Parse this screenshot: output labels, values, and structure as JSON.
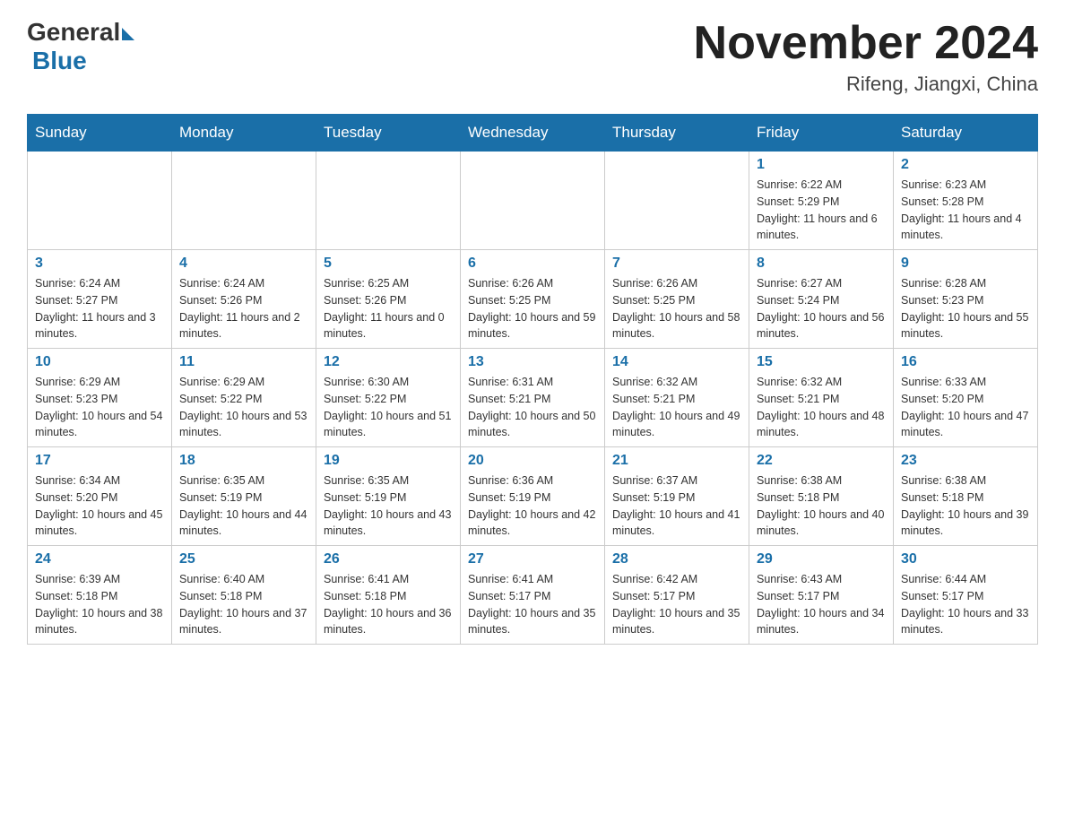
{
  "header": {
    "logo_general": "General",
    "logo_blue": "Blue",
    "month_title": "November 2024",
    "location": "Rifeng, Jiangxi, China"
  },
  "weekdays": [
    "Sunday",
    "Monday",
    "Tuesday",
    "Wednesday",
    "Thursday",
    "Friday",
    "Saturday"
  ],
  "weeks": [
    [
      {
        "day": "",
        "info": ""
      },
      {
        "day": "",
        "info": ""
      },
      {
        "day": "",
        "info": ""
      },
      {
        "day": "",
        "info": ""
      },
      {
        "day": "",
        "info": ""
      },
      {
        "day": "1",
        "info": "Sunrise: 6:22 AM\nSunset: 5:29 PM\nDaylight: 11 hours and 6 minutes."
      },
      {
        "day": "2",
        "info": "Sunrise: 6:23 AM\nSunset: 5:28 PM\nDaylight: 11 hours and 4 minutes."
      }
    ],
    [
      {
        "day": "3",
        "info": "Sunrise: 6:24 AM\nSunset: 5:27 PM\nDaylight: 11 hours and 3 minutes."
      },
      {
        "day": "4",
        "info": "Sunrise: 6:24 AM\nSunset: 5:26 PM\nDaylight: 11 hours and 2 minutes."
      },
      {
        "day": "5",
        "info": "Sunrise: 6:25 AM\nSunset: 5:26 PM\nDaylight: 11 hours and 0 minutes."
      },
      {
        "day": "6",
        "info": "Sunrise: 6:26 AM\nSunset: 5:25 PM\nDaylight: 10 hours and 59 minutes."
      },
      {
        "day": "7",
        "info": "Sunrise: 6:26 AM\nSunset: 5:25 PM\nDaylight: 10 hours and 58 minutes."
      },
      {
        "day": "8",
        "info": "Sunrise: 6:27 AM\nSunset: 5:24 PM\nDaylight: 10 hours and 56 minutes."
      },
      {
        "day": "9",
        "info": "Sunrise: 6:28 AM\nSunset: 5:23 PM\nDaylight: 10 hours and 55 minutes."
      }
    ],
    [
      {
        "day": "10",
        "info": "Sunrise: 6:29 AM\nSunset: 5:23 PM\nDaylight: 10 hours and 54 minutes."
      },
      {
        "day": "11",
        "info": "Sunrise: 6:29 AM\nSunset: 5:22 PM\nDaylight: 10 hours and 53 minutes."
      },
      {
        "day": "12",
        "info": "Sunrise: 6:30 AM\nSunset: 5:22 PM\nDaylight: 10 hours and 51 minutes."
      },
      {
        "day": "13",
        "info": "Sunrise: 6:31 AM\nSunset: 5:21 PM\nDaylight: 10 hours and 50 minutes."
      },
      {
        "day": "14",
        "info": "Sunrise: 6:32 AM\nSunset: 5:21 PM\nDaylight: 10 hours and 49 minutes."
      },
      {
        "day": "15",
        "info": "Sunrise: 6:32 AM\nSunset: 5:21 PM\nDaylight: 10 hours and 48 minutes."
      },
      {
        "day": "16",
        "info": "Sunrise: 6:33 AM\nSunset: 5:20 PM\nDaylight: 10 hours and 47 minutes."
      }
    ],
    [
      {
        "day": "17",
        "info": "Sunrise: 6:34 AM\nSunset: 5:20 PM\nDaylight: 10 hours and 45 minutes."
      },
      {
        "day": "18",
        "info": "Sunrise: 6:35 AM\nSunset: 5:19 PM\nDaylight: 10 hours and 44 minutes."
      },
      {
        "day": "19",
        "info": "Sunrise: 6:35 AM\nSunset: 5:19 PM\nDaylight: 10 hours and 43 minutes."
      },
      {
        "day": "20",
        "info": "Sunrise: 6:36 AM\nSunset: 5:19 PM\nDaylight: 10 hours and 42 minutes."
      },
      {
        "day": "21",
        "info": "Sunrise: 6:37 AM\nSunset: 5:19 PM\nDaylight: 10 hours and 41 minutes."
      },
      {
        "day": "22",
        "info": "Sunrise: 6:38 AM\nSunset: 5:18 PM\nDaylight: 10 hours and 40 minutes."
      },
      {
        "day": "23",
        "info": "Sunrise: 6:38 AM\nSunset: 5:18 PM\nDaylight: 10 hours and 39 minutes."
      }
    ],
    [
      {
        "day": "24",
        "info": "Sunrise: 6:39 AM\nSunset: 5:18 PM\nDaylight: 10 hours and 38 minutes."
      },
      {
        "day": "25",
        "info": "Sunrise: 6:40 AM\nSunset: 5:18 PM\nDaylight: 10 hours and 37 minutes."
      },
      {
        "day": "26",
        "info": "Sunrise: 6:41 AM\nSunset: 5:18 PM\nDaylight: 10 hours and 36 minutes."
      },
      {
        "day": "27",
        "info": "Sunrise: 6:41 AM\nSunset: 5:17 PM\nDaylight: 10 hours and 35 minutes."
      },
      {
        "day": "28",
        "info": "Sunrise: 6:42 AM\nSunset: 5:17 PM\nDaylight: 10 hours and 35 minutes."
      },
      {
        "day": "29",
        "info": "Sunrise: 6:43 AM\nSunset: 5:17 PM\nDaylight: 10 hours and 34 minutes."
      },
      {
        "day": "30",
        "info": "Sunrise: 6:44 AM\nSunset: 5:17 PM\nDaylight: 10 hours and 33 minutes."
      }
    ]
  ]
}
